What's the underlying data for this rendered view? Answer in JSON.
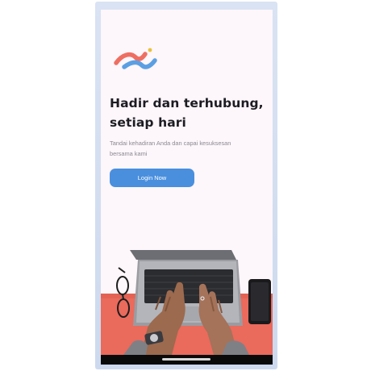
{
  "onboarding": {
    "logo_icon": "brand-swoosh-logo",
    "headline_line1": "Hadir dan terhubung,",
    "headline_line2": "setiap hari",
    "subtitle_line1": "Tandai kehadiran Anda dan capai kesuksesan",
    "subtitle_line2": "bersama kami",
    "login_label": "Login Now",
    "hero_image": "laptop-typing-photo"
  },
  "colors": {
    "background": "#fdf6fa",
    "primary_button": "#4a8fde",
    "button_text": "#ffffff",
    "headline": "#1c1c22",
    "subtitle": "#8a8a92",
    "logo_coral": "#ee6f62",
    "logo_blue": "#5b9fe3",
    "desk": "#ea6a5c",
    "nav_bar": "#0a0a0a"
  }
}
